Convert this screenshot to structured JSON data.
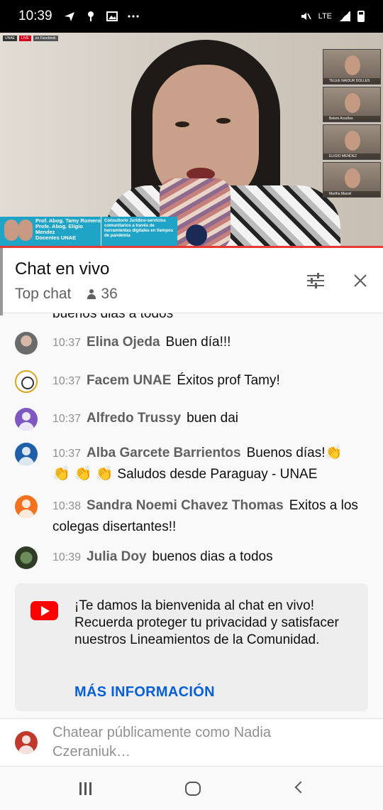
{
  "status_bar": {
    "time": "10:39",
    "network": "LTE"
  },
  "video": {
    "live_badges": [
      "UNAE",
      "LIVE",
      "en Facebook"
    ],
    "participants": [
      "TELEE NAIDUR DOLLES",
      "Belem Arzaños",
      "ELIGIO MENDEZ",
      "Martha Maciel"
    ],
    "banner": {
      "names": [
        "Prof. Abog. Tamy Romero",
        "Profe. Abog. Eligio Mendez",
        "Docentes UNAE"
      ],
      "topic": "Consultorio Jurídico-servicios comunitarios a través de herramientas digitales en tiempos de pandemia"
    }
  },
  "chat": {
    "title": "Chat en vivo",
    "mode": "Top chat",
    "viewer_count": "36",
    "cut_message": "buenos dias a todos",
    "messages": [
      {
        "time": "10:37",
        "author": "Elina Ojeda",
        "text": "Buen día!!!"
      },
      {
        "time": "10:37",
        "author": "Facem UNAE",
        "text": "Éxitos prof Tamy!"
      },
      {
        "time": "10:37",
        "author": "Alfredo Trussy",
        "text": "buen dai"
      },
      {
        "time": "10:37",
        "author": "Alba Garcete Barrientos",
        "text": "Buenos días!👏",
        "text2": "Saludos desde Paraguay - UNAE"
      },
      {
        "time": "10:38",
        "author": "Sandra Noemi Chavez Thomas",
        "text": "Exitos a los colegas disertantes!!"
      },
      {
        "time": "10:39",
        "author": "Julia Doy",
        "text": "buenos dias a todos"
      }
    ],
    "welcome": {
      "text": "¡Te damos la bienvenida al chat en vivo! Recuerda proteger tu privacidad y satisfacer nuestros Lineamientos de la Comunidad.",
      "link": "MÁS INFORMACIÓN"
    },
    "input_placeholder": "Chatear públicamente como Nadia Czeraniuk…"
  },
  "colors": {
    "accent_red": "#ff0000",
    "link_blue": "#065fd4",
    "banner_blue": "#1fa3c7"
  }
}
